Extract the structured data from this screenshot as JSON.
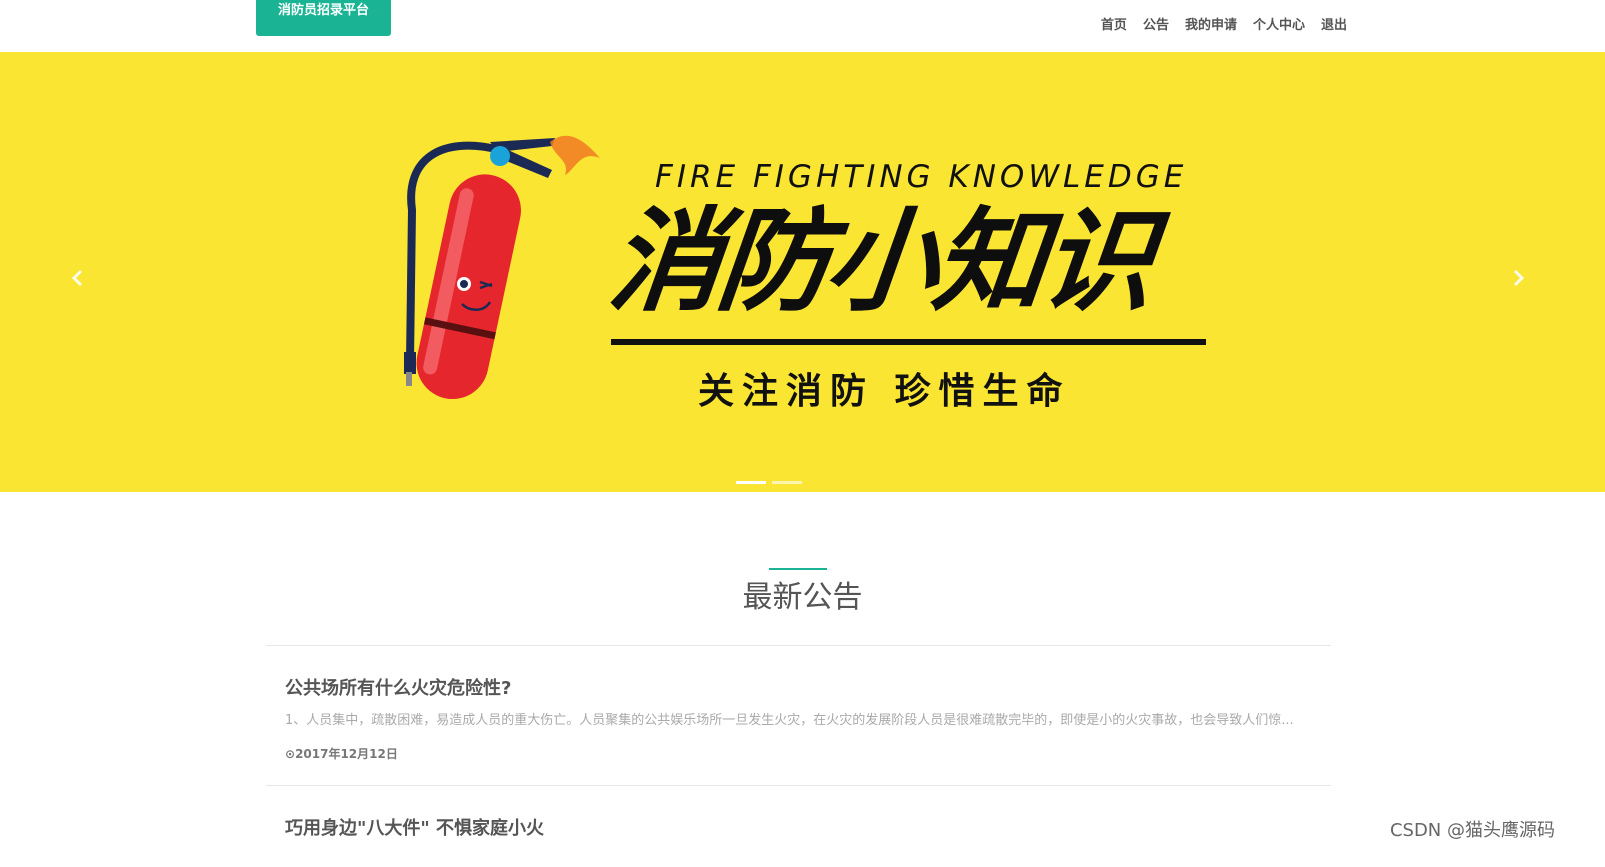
{
  "header": {
    "logo": "消防员招录平台",
    "nav": [
      "首页",
      "公告",
      "我的申请",
      "个人中心",
      "退出"
    ]
  },
  "banner": {
    "title_en": "FIRE FIGHTING KNOWLEDGE",
    "title_cn": "消防小知识",
    "subtitle": "关注消防 珍惜生命",
    "background": "#fae532",
    "prev_icon": "chevron-left-icon",
    "next_icon": "chevron-right-icon"
  },
  "section": {
    "title": "最新公告",
    "accent": "#1ab394"
  },
  "announcements": [
    {
      "title": "公共场所有什么火灾危险性?",
      "summary": "1、人员集中，疏散困难，易造成人员的重大伤亡。人员聚集的公共娱乐场所一旦发生火灾，在火灾的发展阶段人员是很难疏散完毕的，即使是小的火灾事故，也会导致人们惊...",
      "date": "2017年12月12日"
    },
    {
      "title": "巧用身边\"八大件\" 不惧家庭小火"
    }
  ],
  "watermark": "CSDN @猫头鹰源码"
}
